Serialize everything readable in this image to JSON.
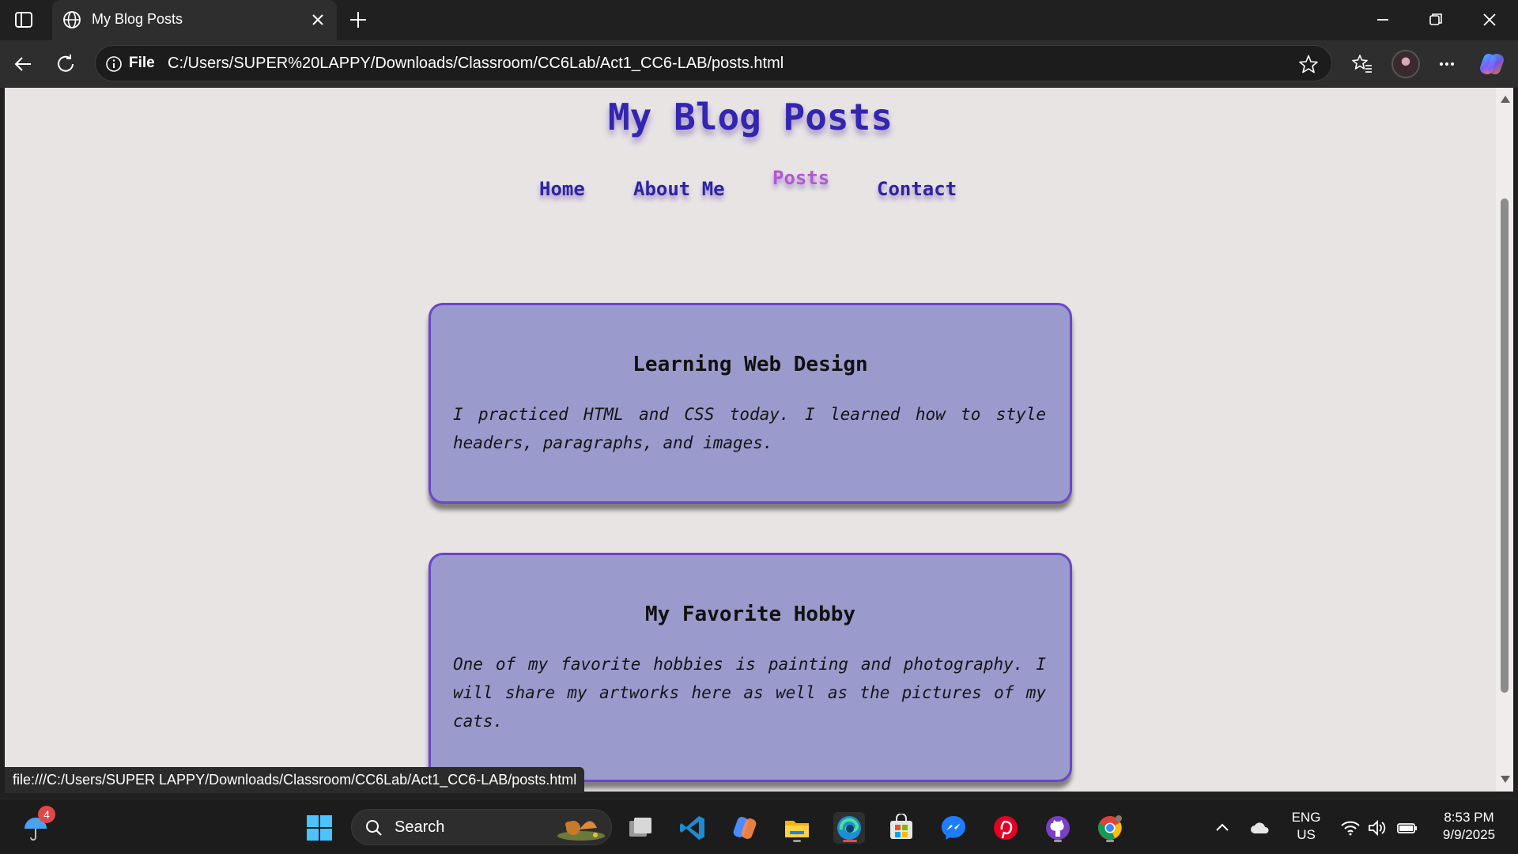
{
  "browser": {
    "tab_title": "My Blog Posts",
    "file_chip": "File",
    "url": "C:/Users/SUPER%20LAPPY/Downloads/Classroom/CC6Lab/Act1_CC6-LAB/posts.html",
    "status_url": "file:///C:/Users/SUPER LAPPY/Downloads/Classroom/CC6Lab/Act1_CC6-LAB/posts.html"
  },
  "page": {
    "heading": "My Blog Posts",
    "nav": [
      {
        "label": "Home"
      },
      {
        "label": "About Me"
      },
      {
        "label": "Posts"
      },
      {
        "label": "Contact"
      }
    ],
    "active_nav": "Posts",
    "posts": [
      {
        "title": "Learning Web Design",
        "body": "I practiced HTML and CSS today. I learned how to style headers, paragraphs, and images."
      },
      {
        "title": "My Favorite Hobby",
        "body": "One of my favorite hobbies is painting and photography. I will share my artworks here as well as the pictures of my cats."
      }
    ]
  },
  "taskbar": {
    "weather_badge": "4",
    "search_label": "Search",
    "apps": [
      "task-view",
      "vscode",
      "copilot",
      "file-explorer",
      "edge",
      "microsoft-store",
      "messenger",
      "pinterest",
      "github",
      "chrome"
    ],
    "lang_top": "ENG",
    "lang_bottom": "US",
    "time": "8:53 PM",
    "date": "9/9/2025"
  },
  "colors": {
    "heading": "#3325b0",
    "nav_active": "#b357d8",
    "card_bg": "#9a9acd",
    "card_border": "#6a46c8",
    "page_bg": "#e8e4e4"
  }
}
